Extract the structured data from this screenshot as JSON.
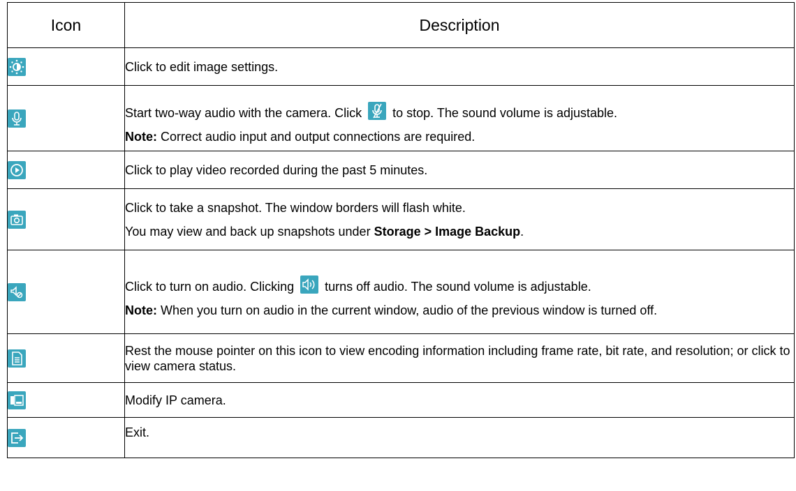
{
  "table": {
    "headers": {
      "icon": "Icon",
      "description": "Description"
    },
    "rows": [
      {
        "icon": "image-settings-icon",
        "paragraphs": [
          {
            "text": "Click to edit image settings."
          }
        ]
      },
      {
        "icon": "microphone-icon",
        "paragraphs": [
          {
            "before": "Start two-way audio with the camera. Click",
            "inline_icon": "microphone-muted-icon",
            "after": "to stop. The sound volume is adjustable."
          },
          {
            "bold": "Note:",
            "text": " Correct audio input and output connections are required."
          }
        ]
      },
      {
        "icon": "play-icon",
        "paragraphs": [
          {
            "text": "Click to play video recorded during the past 5 minutes."
          }
        ]
      },
      {
        "icon": "camera-icon",
        "paragraphs": [
          {
            "text": "Click to take a snapshot. The window borders will flash white."
          },
          {
            "text": "You may view and back up snapshots under ",
            "bold": "Storage > Image Backup",
            "after": "."
          }
        ]
      },
      {
        "icon": "speaker-muted-icon",
        "paragraphs": [
          {
            "before": "Click to turn on audio. Clicking",
            "inline_icon": "speaker-on-icon",
            "after": "turns off audio. The sound volume is adjustable."
          },
          {
            "bold": "Note:",
            "text": " When you turn on audio in the current window, audio of the previous window is turned off."
          }
        ]
      },
      {
        "icon": "document-icon",
        "paragraphs": [
          {
            "text": "Rest the mouse pointer on this icon to view encoding information including frame rate, bit rate, and resolution; or click to view camera status."
          }
        ]
      },
      {
        "icon": "ip-camera-icon",
        "paragraphs": [
          {
            "text": "Modify IP camera."
          }
        ]
      },
      {
        "icon": "exit-icon",
        "paragraphs": [
          {
            "text": "Exit."
          }
        ]
      }
    ]
  }
}
